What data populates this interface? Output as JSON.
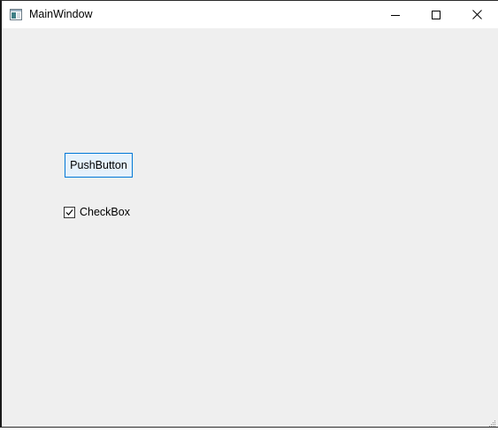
{
  "window": {
    "title": "MainWindow",
    "icon": "window-app-icon",
    "controls": {
      "minimize_icon": "minimize-icon",
      "maximize_icon": "maximize-icon",
      "close_icon": "close-icon"
    }
  },
  "content": {
    "push_button_label": "PushButton",
    "checkbox": {
      "label": "CheckBox",
      "checked": true
    }
  },
  "colors": {
    "client_background": "#efefef",
    "titlebar_background": "#ffffff",
    "button_border": "#0078d7",
    "button_background": "#e5f1fb"
  }
}
